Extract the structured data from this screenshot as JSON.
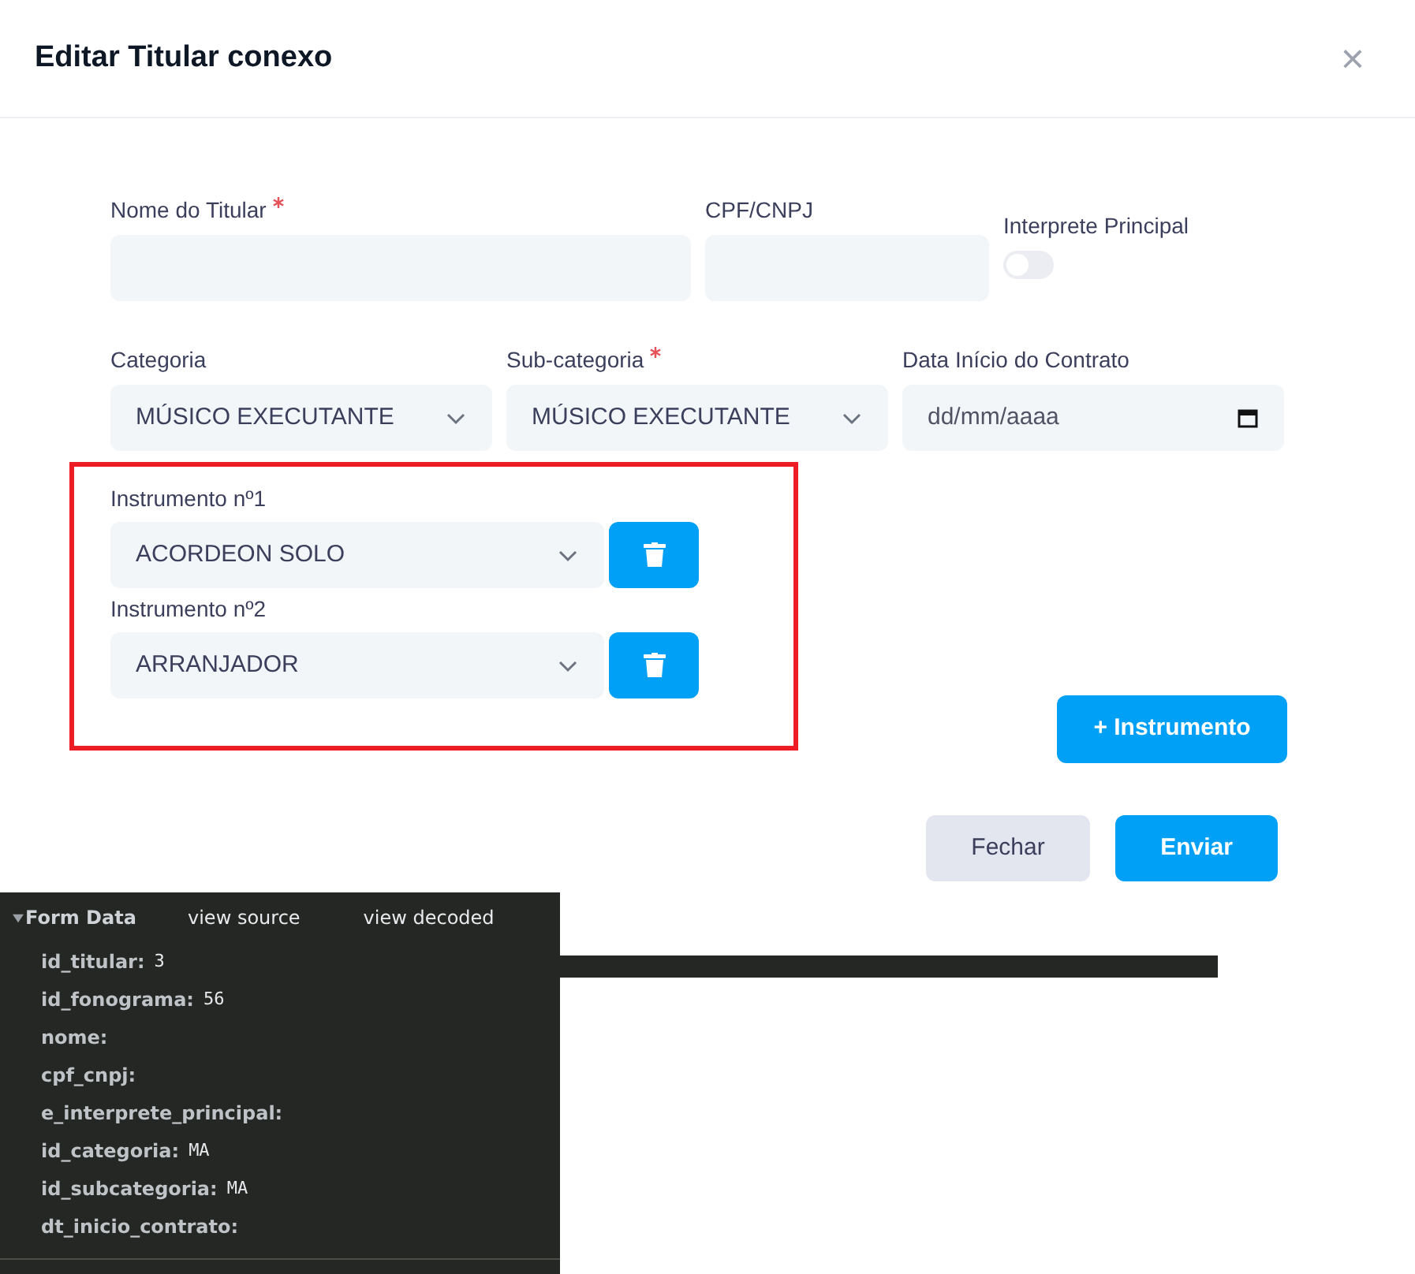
{
  "dialog": {
    "title": "Editar Titular conexo",
    "close": "×"
  },
  "fields": [
    {
      "label": "Nome do Titular",
      "required": true,
      "kind": "text"
    },
    {
      "label": "CPF/CNPJ",
      "required": false,
      "kind": "text"
    },
    {
      "label": "Interprete Principal",
      "required": false,
      "kind": "toggle",
      "on": false
    }
  ],
  "fields_row2": [
    {
      "label": "Categoria",
      "required": false,
      "kind": "select",
      "value": "MÚSICO EXECUTANTE"
    },
    {
      "label": "Sub-categoria",
      "required": true,
      "kind": "select",
      "value": "MÚSICO EXECUTANTE"
    },
    {
      "label": "Data Início do Contrato",
      "required": false,
      "kind": "date",
      "placeholder": "dd/mm/aaaa"
    }
  ],
  "instruments": [
    {
      "label": "Instrumento nº1",
      "value": "ACORDEON SOLO"
    },
    {
      "label": "Instrumento nº2",
      "value": "ARRANJADOR"
    }
  ],
  "add_button": "+ Instrumento",
  "buttons": [
    {
      "label": "Fechar",
      "kind": "secondary"
    },
    {
      "label": "Enviar",
      "kind": "primary"
    }
  ],
  "form_data": {
    "title": "Form Data",
    "expanded": true,
    "links": [
      "view source",
      "view decoded"
    ],
    "rows": [
      {
        "key": "id_titular:",
        "value": "3"
      },
      {
        "key": "id_fonograma:",
        "value": "56"
      },
      {
        "key": "nome:"
      },
      {
        "key": "cpf_cnpj:"
      },
      {
        "key": "e_interprete_principal:"
      },
      {
        "key": "id_categoria:",
        "value": "MA"
      },
      {
        "key": "id_subcategoria:",
        "value": "MA"
      },
      {
        "key": "dt_inicio_contrato:"
      }
    ]
  }
}
